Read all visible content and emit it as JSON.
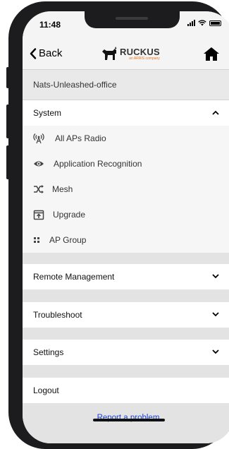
{
  "status_bar": {
    "time": "11:48"
  },
  "nav": {
    "back_label": "Back",
    "logo_word": "RUCKUS",
    "logo_tagline": "an ARRIS company"
  },
  "site_name": "Nats-Unleashed-office",
  "sections": {
    "system": {
      "label": "System",
      "expanded": true,
      "items": [
        {
          "label": "All APs Radio",
          "icon": "antenna-icon"
        },
        {
          "label": "Application Recognition",
          "icon": "eye-icon"
        },
        {
          "label": "Mesh",
          "icon": "shuffle-icon"
        },
        {
          "label": "Upgrade",
          "icon": "upgrade-icon"
        },
        {
          "label": "AP Group",
          "icon": "grid-icon"
        }
      ]
    },
    "remote_management": {
      "label": "Remote Management"
    },
    "troubleshoot": {
      "label": "Troubleshoot"
    },
    "settings": {
      "label": "Settings"
    },
    "logout": {
      "label": "Logout"
    }
  },
  "footer": {
    "report_label": "Report a problem"
  },
  "colors": {
    "link": "#1a3fd6",
    "brand_orange": "#e87722"
  }
}
